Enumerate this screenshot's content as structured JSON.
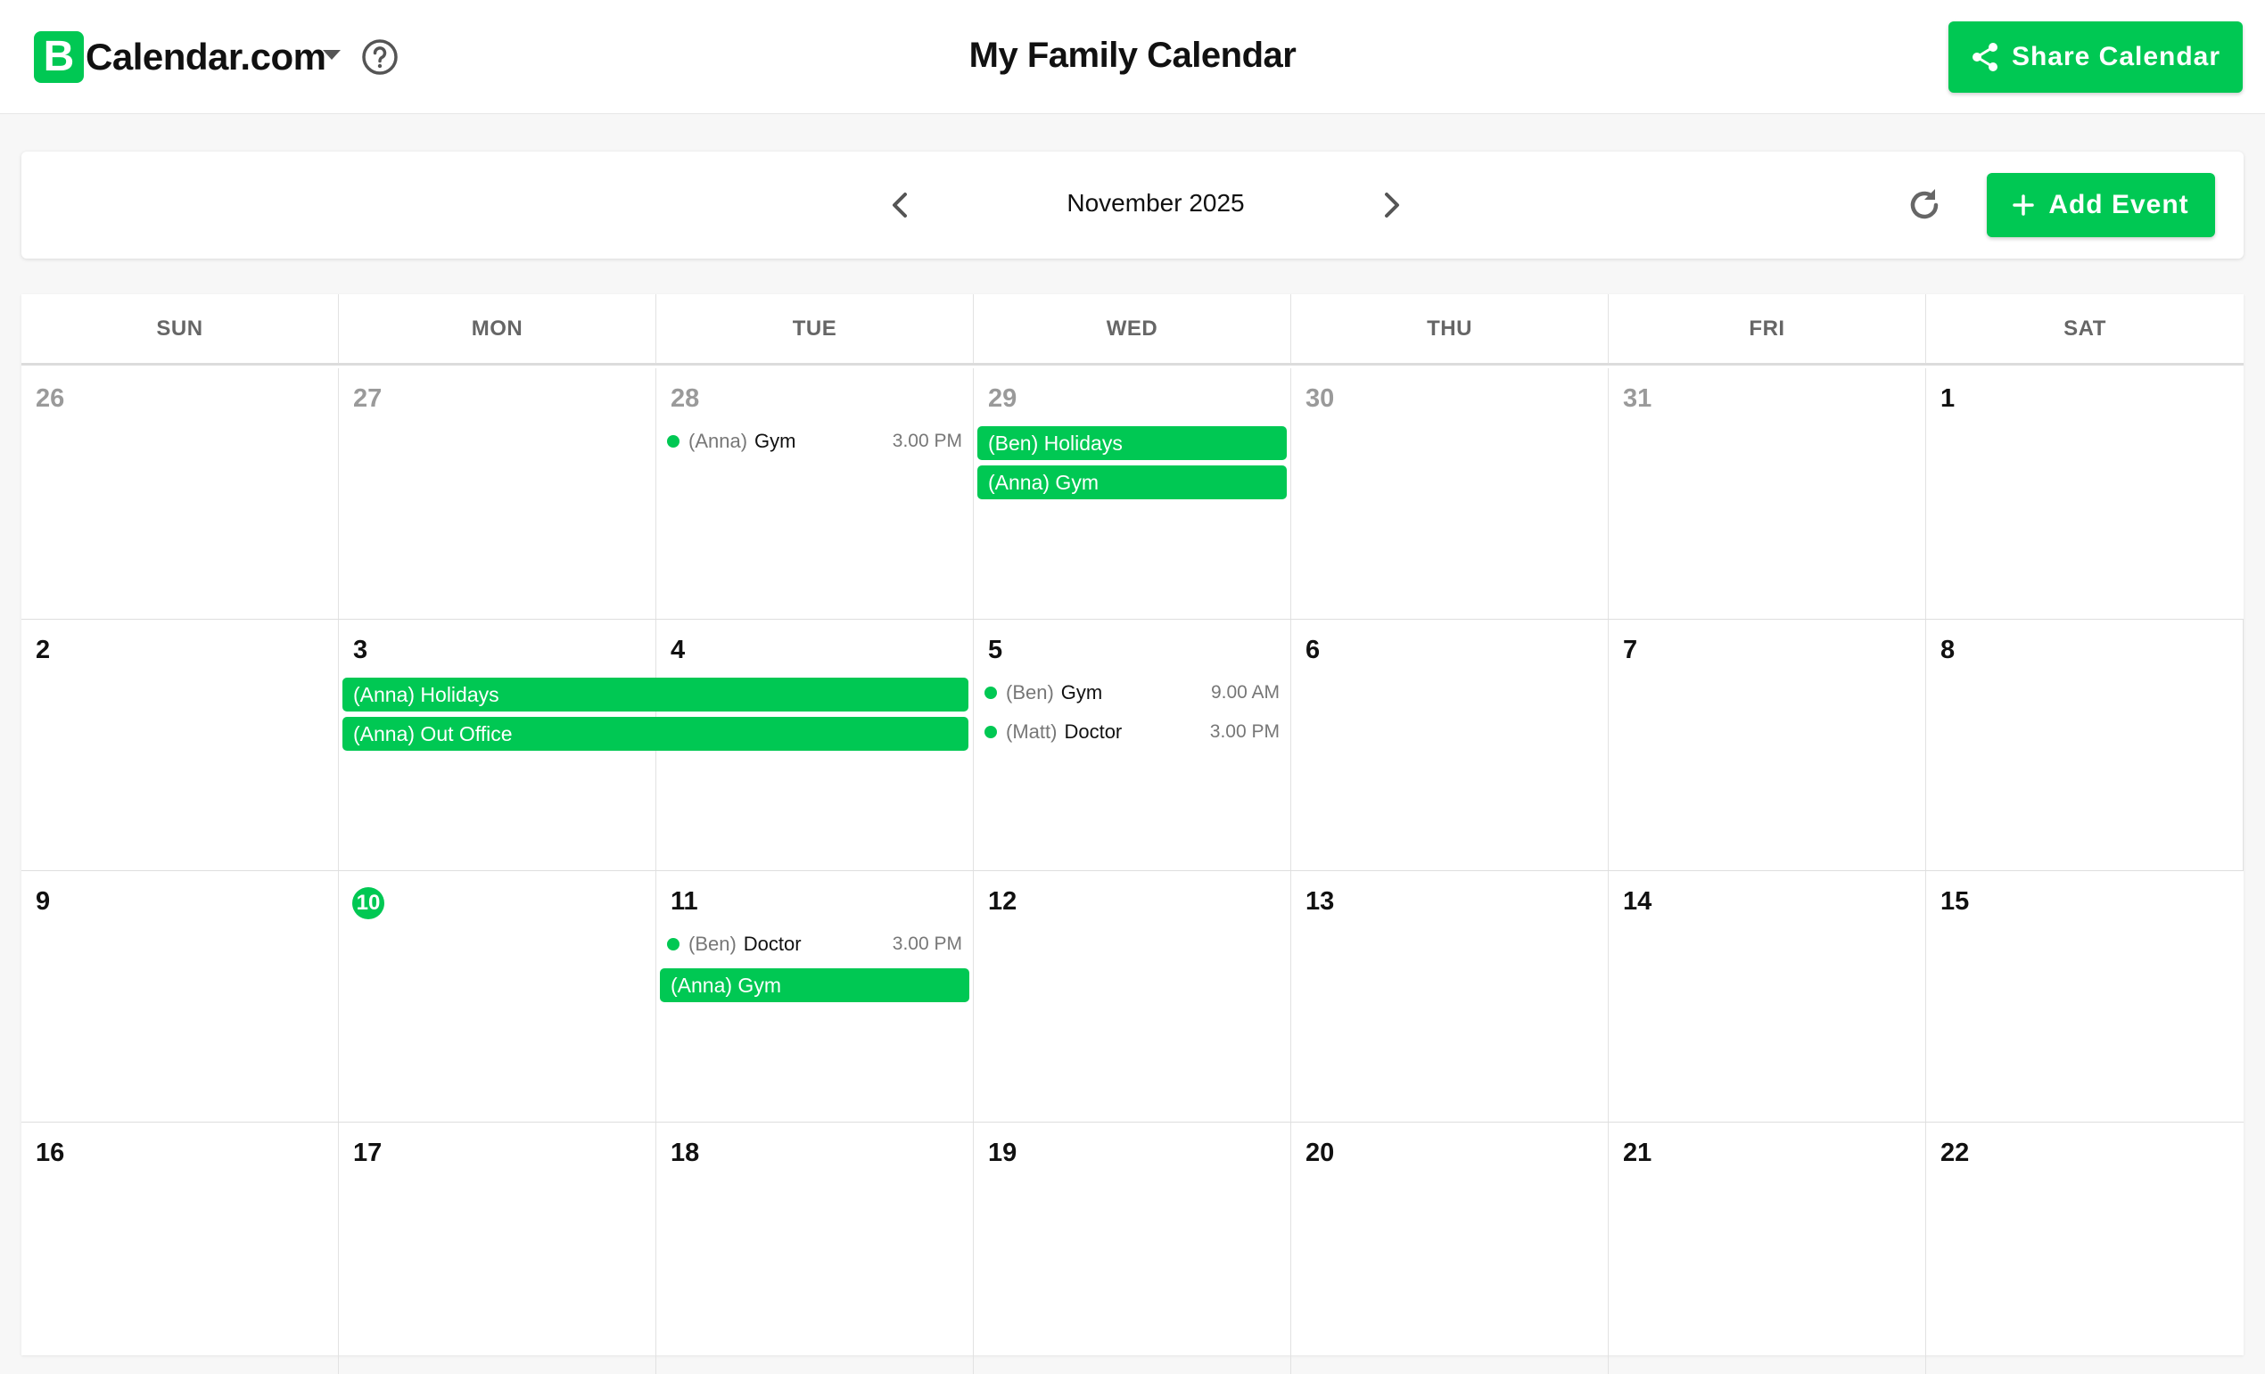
{
  "header": {
    "logo_letter": "B",
    "logo_text": "Calendar.com",
    "title": "My Family Calendar",
    "share_label": "Share Calendar"
  },
  "toolbar": {
    "month": "November 2025",
    "add_label": "Add Event"
  },
  "weekdays": [
    "SUN",
    "MON",
    "TUE",
    "WED",
    "THU",
    "FRI",
    "SAT"
  ],
  "weeks": [
    [
      "26",
      "27",
      "28",
      "29",
      "30",
      "31",
      "1"
    ],
    [
      "2",
      "3",
      "4",
      "5",
      "6",
      "7",
      "8"
    ],
    [
      "9",
      "10",
      "11",
      "12",
      "13",
      "14",
      "15"
    ],
    [
      "16",
      "17",
      "18",
      "19",
      "20",
      "21",
      "22"
    ]
  ],
  "events": {
    "tue28_gym": {
      "who": "(Anna)",
      "name": "Gym",
      "time": "3.00 PM"
    },
    "wed29_ben_holidays": "(Ben) Holidays",
    "wed29_anna_gym": "(Anna) Gym",
    "anna_holidays": "(Anna) Holidays",
    "anna_out_office": "(Anna) Out Office",
    "wed5_gym": {
      "who": "(Ben)",
      "name": "Gym",
      "time": "9.00 AM"
    },
    "wed5_doctor": {
      "who": "(Matt)",
      "name": "Doctor",
      "time": "3.00 PM"
    },
    "tue11_doctor": {
      "who": "(Ben)",
      "name": "Doctor",
      "time": "3.00 PM"
    },
    "tue11_anna_gym": "(Anna) Gym"
  },
  "colors": {
    "accent": "#00c853",
    "muted_text": "#9a9a9a"
  },
  "icons": [
    "caret-down-icon",
    "help-icon",
    "share-icon",
    "chevron-left-icon",
    "chevron-right-icon",
    "refresh-icon",
    "plus-icon"
  ]
}
